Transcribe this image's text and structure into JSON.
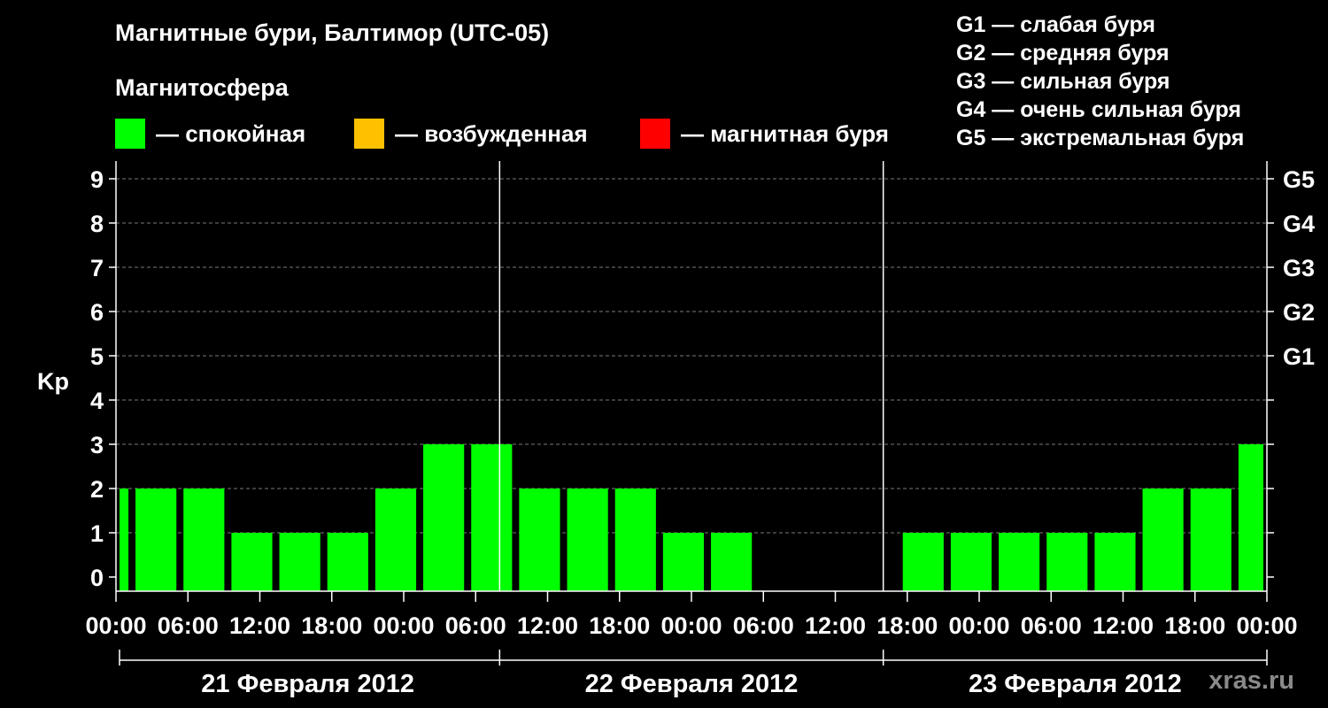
{
  "header": {
    "title": "Магнитные бури, Балтимор (UTC-05)",
    "subtitle": "Магнитосфера"
  },
  "legend": {
    "items": [
      {
        "label": "— спокойная",
        "color": "#00ff00"
      },
      {
        "label": "— возбужденная",
        "color": "#ffc000"
      },
      {
        "label": "— магнитная буря",
        "color": "#ff0000"
      }
    ]
  },
  "storm_legend": [
    "G1 — слабая буря",
    "G2 — средняя буря",
    "G3 — сильная буря",
    "G4 — очень сильная буря",
    "G5 — экстремальная буря"
  ],
  "watermark": "xras.ru",
  "chart_data": {
    "type": "bar",
    "ylabel": "Kp",
    "ylim": [
      0,
      9
    ],
    "y_ticks": [
      "0",
      "1",
      "2",
      "3",
      "4",
      "5",
      "6",
      "7",
      "8",
      "9"
    ],
    "right_axis_ticks": [
      {
        "kp": 5,
        "label": "G1"
      },
      {
        "kp": 6,
        "label": "G2"
      },
      {
        "kp": 7,
        "label": "G3"
      },
      {
        "kp": 8,
        "label": "G4"
      },
      {
        "kp": 9,
        "label": "G5"
      }
    ],
    "x_tick_labels": [
      "00:00",
      "06:00",
      "12:00",
      "18:00",
      "00:00",
      "06:00",
      "12:00",
      "18:00",
      "00:00",
      "06:00",
      "12:00",
      "18:00",
      "00:00",
      "06:00",
      "12:00",
      "18:00",
      "00:00"
    ],
    "x_range_hours": [
      0,
      72
    ],
    "days": [
      "21 Февраля 2012",
      "22 Февраля 2012",
      "23 Февраля 2012"
    ],
    "bar_color": "#00ff00",
    "bars": [
      {
        "start_h": 0,
        "end_h": 1,
        "kp": 2
      },
      {
        "start_h": 1,
        "end_h": 4,
        "kp": 2
      },
      {
        "start_h": 4,
        "end_h": 7,
        "kp": 2
      },
      {
        "start_h": 7,
        "end_h": 10,
        "kp": 1
      },
      {
        "start_h": 10,
        "end_h": 13,
        "kp": 1
      },
      {
        "start_h": 13,
        "end_h": 16,
        "kp": 1
      },
      {
        "start_h": 16,
        "end_h": 19,
        "kp": 2
      },
      {
        "start_h": 19,
        "end_h": 22,
        "kp": 3
      },
      {
        "start_h": 22,
        "end_h": 25,
        "kp": 3
      },
      {
        "start_h": 25,
        "end_h": 28,
        "kp": 2
      },
      {
        "start_h": 28,
        "end_h": 31,
        "kp": 2
      },
      {
        "start_h": 31,
        "end_h": 34,
        "kp": 2
      },
      {
        "start_h": 34,
        "end_h": 37,
        "kp": 1
      },
      {
        "start_h": 37,
        "end_h": 40,
        "kp": 1
      },
      {
        "start_h": 49,
        "end_h": 52,
        "kp": 1
      },
      {
        "start_h": 52,
        "end_h": 55,
        "kp": 1
      },
      {
        "start_h": 55,
        "end_h": 58,
        "kp": 1
      },
      {
        "start_h": 58,
        "end_h": 61,
        "kp": 1
      },
      {
        "start_h": 61,
        "end_h": 64,
        "kp": 1
      },
      {
        "start_h": 64,
        "end_h": 67,
        "kp": 2
      },
      {
        "start_h": 67,
        "end_h": 70,
        "kp": 2
      },
      {
        "start_h": 70,
        "end_h": 72,
        "kp": 3
      }
    ]
  }
}
